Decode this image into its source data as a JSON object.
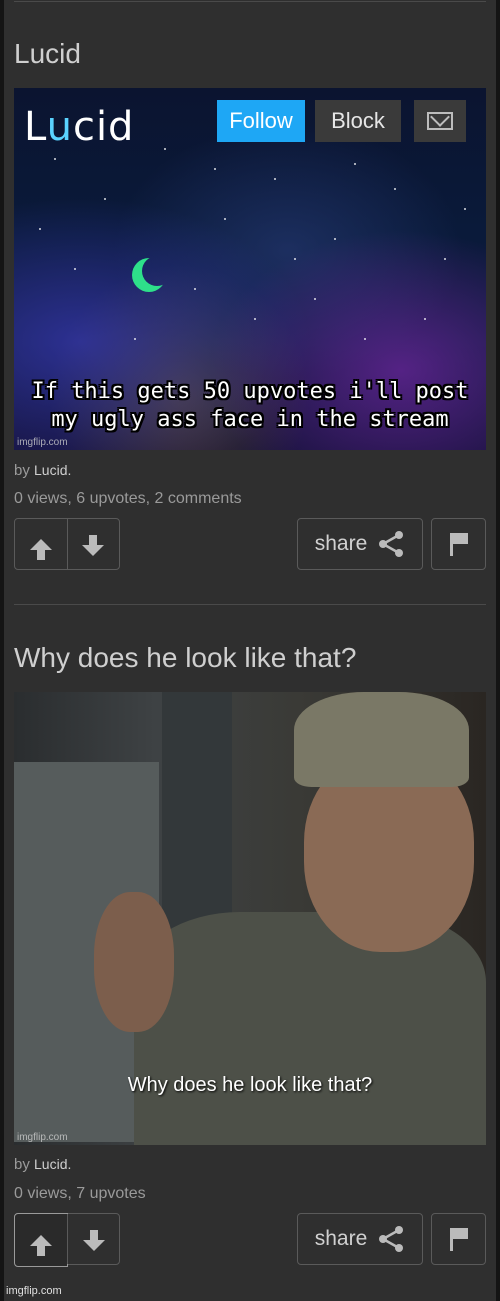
{
  "posts": [
    {
      "title": "Lucid",
      "meme": {
        "logo_prefix": "L",
        "logo_highlight": "u",
        "logo_suffix": "cid",
        "follow_label": "Follow",
        "block_label": "Block",
        "caption": "If this gets 50 upvotes i'll post my ugly ass face in the stream",
        "watermark": "imgflip.com"
      },
      "by_label": "by",
      "author": "Lucid.",
      "stats": "0 views, 6 upvotes, 2 comments",
      "share_label": "share",
      "upvoted": false
    },
    {
      "title": "Why does he look like that?",
      "meme": {
        "caption": "Why does he look like that?",
        "watermark": "imgflip.com"
      },
      "by_label": "by",
      "author": "Lucid.",
      "stats": "0 views, 7 upvotes",
      "share_label": "share",
      "upvoted": true
    }
  ],
  "footer_watermark": "imgflip.com",
  "colors": {
    "background": "#2f2f2f",
    "follow": "#1ea7f5",
    "text_muted": "#9a9a9a"
  },
  "icons": [
    "upvote-arrow-icon",
    "downvote-arrow-icon",
    "share-icon",
    "flag-icon",
    "mail-icon"
  ]
}
